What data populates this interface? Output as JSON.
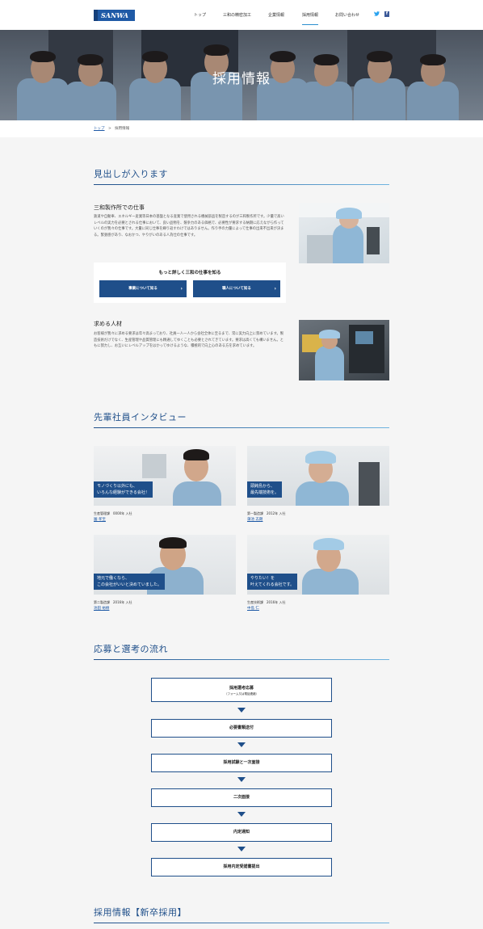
{
  "header": {
    "logo": "SANWA",
    "nav": [
      "トップ",
      "三和の精密加工",
      "企業情報",
      "採用情報",
      "お問い合わせ"
    ],
    "twitter_icon": "twitter-icon",
    "facebook_icon": "facebook-icon",
    "facebook_glyph": "f",
    "active_color": "#2c8fd0"
  },
  "hero": {
    "title": "採用情報"
  },
  "breadcrumb": {
    "home": "トップ",
    "sep": ">",
    "current": "採用情報"
  },
  "section1": {
    "title": "見出しが入ります",
    "work": {
      "title": "三和製作所での仕事",
      "text": "鉄道や自動車、エネルギー産業等日本の基盤となる産業で使用される機械部品を製造するのが三和製作所です。少量で高いレベルの実力を必要とされる仕事において、良い品物を、競争力のある価格で、必要性が要求する納期に応えながら作っていくのが我々の仕事です。大量に同じ仕事を繰り返すわけではありません。作り手の力量によって仕事の出来不出来が決まる。緊張感があり、なおかつ、やりがいのある人為仕の仕事です。"
    },
    "more": {
      "title": "もっと詳しく三和の仕事を知る",
      "btn_business": "事業について知る",
      "btn_people": "職人について知る"
    },
    "people": {
      "title": "求める人材",
      "text": "お客様が我々に求める要求は年々高まっており、社員一人一人から会社全体に至るまで、常に実力向上に努めています。製造技術だけでなく、生産管理や品質管理にも精通してゆくことも必要とされてきています。要求は高くても構いません。ともに努力し、お互いにレベルアップをはかってゆけるような、積極的で向上心のある方を求めています。"
    }
  },
  "section2": {
    "title": "先輩社員インタビュー",
    "cards": [
      {
        "caption1": "モノづくり以外にも、",
        "caption2": "いろんな経験ができる会社！",
        "meta": "生産管理課　0000年 入社",
        "name": "園 孝至"
      },
      {
        "caption1": "頭鈍島から、",
        "caption2": "最先端技術を。",
        "meta": "第一製造課　2012年 入社",
        "name": "蒲池 志朗"
      },
      {
        "caption1": "地元で働くなら、",
        "caption2": "この会社がいいと決めていました。",
        "meta": "第二製造課　2016年 入社",
        "name": "池田 裕樹"
      },
      {
        "caption1": "やりたい！を",
        "caption2": "叶えてくれる会社です。",
        "meta": "生産技術課　2016年 入社",
        "name": "中島 仁"
      }
    ]
  },
  "section3": {
    "title": "応募と選考の流れ",
    "steps": [
      {
        "label": "採用選考応募",
        "sub": "（フォーム又は電話連絡）"
      },
      {
        "label": "必要書類送付"
      },
      {
        "label": "採用試験と一次面接"
      },
      {
        "label": "二次面接"
      },
      {
        "label": "内定通知"
      },
      {
        "label": "採用内定受諾書提出"
      }
    ]
  },
  "section4": {
    "title": "採用情報【新卒採用】"
  },
  "colors": {
    "brand": "#1f4f8a",
    "accent": "#6fb4e0",
    "background": "#f5f5f5"
  }
}
